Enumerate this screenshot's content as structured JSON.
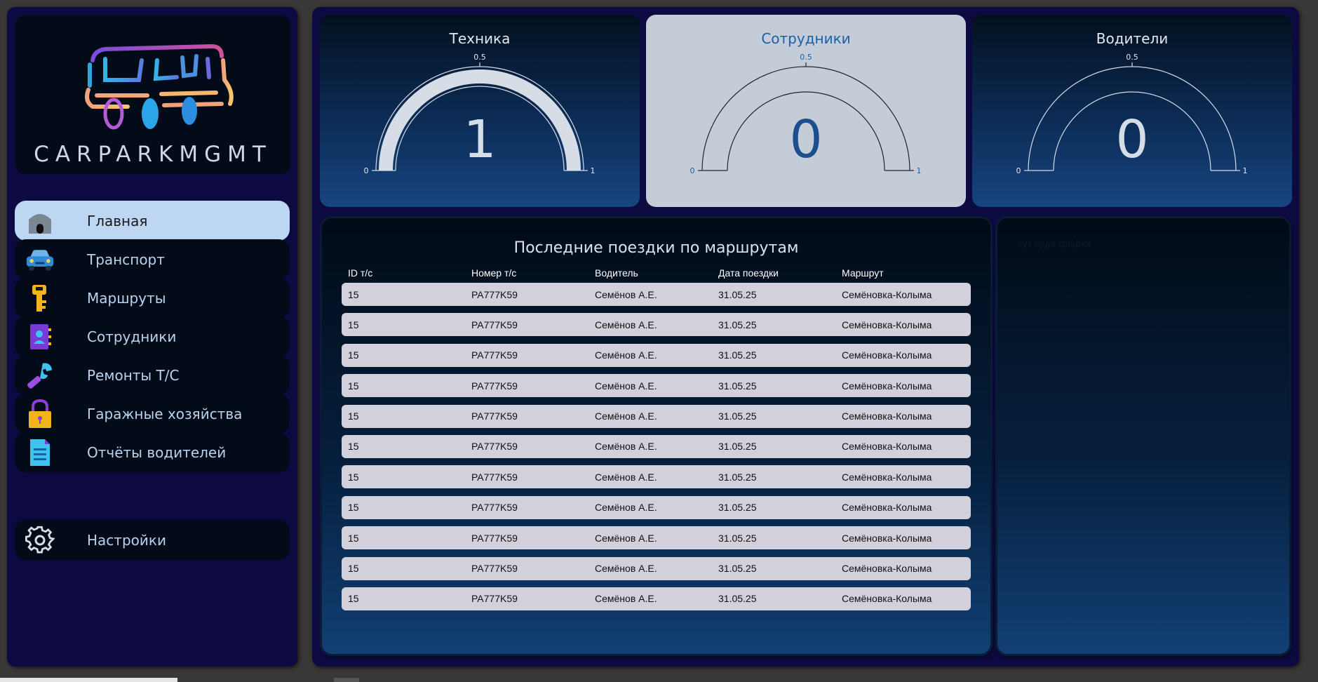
{
  "app": {
    "logo_text": "CARPARKMGMT"
  },
  "sidebar": {
    "items": [
      {
        "label": "Главная",
        "icon": "home-icon",
        "active": true
      },
      {
        "label": "Транспорт",
        "icon": "car-icon",
        "active": false
      },
      {
        "label": "Маршруты",
        "icon": "key-icon",
        "active": false
      },
      {
        "label": "Сотрудники",
        "icon": "contacts-book-icon",
        "active": false
      },
      {
        "label": "Ремонты Т/С",
        "icon": "wrench-icon",
        "active": false
      },
      {
        "label": "Гаражные хозяйства",
        "icon": "lock-icon",
        "active": false
      },
      {
        "label": "Отчёты водителей",
        "icon": "document-icon",
        "active": false
      }
    ],
    "settings": {
      "label": "Настройки",
      "icon": "gear-icon"
    }
  },
  "gauges": [
    {
      "title": "Техника",
      "value": "1",
      "fill_fraction": 1,
      "min": "0",
      "mid": "0.5",
      "max": "1",
      "theme": "dark"
    },
    {
      "title": "Сотрудники",
      "value": "0",
      "fill_fraction": 0,
      "min": "0",
      "mid": "0.5",
      "max": "1",
      "theme": "light"
    },
    {
      "title": "Водители",
      "value": "0",
      "fill_fraction": 0,
      "min": "0",
      "mid": "0.5",
      "max": "1",
      "theme": "dark"
    }
  ],
  "trips": {
    "title": "Последние поездки по маршрутам",
    "columns": [
      "ID т/с",
      "Номер т/с",
      "Водитель",
      "Дата поездки",
      "Маршрут"
    ],
    "rows": [
      [
        "15",
        "PA777K59",
        "Семёнов А.Е.",
        "31.05.25",
        "Семёновка-Колыма"
      ],
      [
        "15",
        "PA777K59",
        "Семёнов А.Е.",
        "31.05.25",
        "Семёновка-Колыма"
      ],
      [
        "15",
        "PA777K59",
        "Семёнов А.Е.",
        "31.05.25",
        "Семёновка-Колыма"
      ],
      [
        "15",
        "PA777K59",
        "Семёнов А.Е.",
        "31.05.25",
        "Семёновка-Колыма"
      ],
      [
        "15",
        "PA777K59",
        "Семёнов А.Е.",
        "31.05.25",
        "Семёновка-Колыма"
      ],
      [
        "15",
        "PA777K59",
        "Семёнов А.Е.",
        "31.05.25",
        "Семёновка-Колыма"
      ],
      [
        "15",
        "PA777K59",
        "Семёнов А.Е.",
        "31.05.25",
        "Семёновка-Колыма"
      ],
      [
        "15",
        "PA777K59",
        "Семёнов А.Е.",
        "31.05.25",
        "Семёновка-Колыма"
      ],
      [
        "15",
        "PA777K59",
        "Семёнов А.Е.",
        "31.05.25",
        "Семёновка-Колыма"
      ],
      [
        "15",
        "PA777K59",
        "Семёнов А.Е.",
        "31.05.25",
        "Семёновка-Колыма"
      ],
      [
        "15",
        "PA777K59",
        "Семёнов А.Е.",
        "31.05.25",
        "Семёновка-Колыма"
      ]
    ]
  },
  "chart_panel": {
    "placeholder": "тут буда графки"
  },
  "colors": {
    "accent_active": "#bdd6f2",
    "panel_dark": "#020b17",
    "frame": "#0c0a40"
  }
}
